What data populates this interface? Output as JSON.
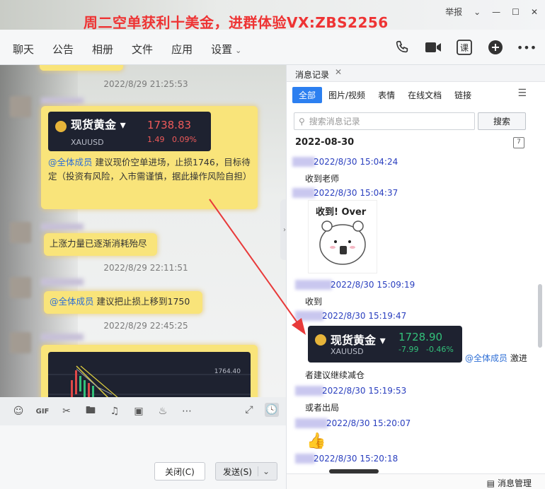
{
  "window": {
    "promo": "周二空单获利十美金，进群体验VX:ZBS2256",
    "report": "举报"
  },
  "tabs": [
    {
      "label": "聊天"
    },
    {
      "label": "公告"
    },
    {
      "label": "相册"
    },
    {
      "label": "文件"
    },
    {
      "label": "应用"
    },
    {
      "label": "设置"
    }
  ],
  "top_icons": [
    "phone-icon",
    "video-icon",
    "class-icon",
    "add-chat-icon",
    "more-icon"
  ],
  "chat": {
    "messages": [
      {
        "time": "2022/8/29 21:25:53"
      },
      {
        "quote": {
          "name": "现货黄金",
          "symbol": "XAUUSD",
          "price": "1738.83",
          "change": "1.49",
          "change_pct": "0.09%"
        },
        "mention": "@全体成员",
        "text": " 建议现价空单进场，止损1746，目标待定（投资有风险，入市需谨慎，据此操作风险自担）"
      },
      {
        "text": "上涨力量已逐渐消耗殆尽"
      },
      {
        "time": "2022/8/29 22:11:51"
      },
      {
        "mention": "@全体成员",
        "text": " 建议把止损上移到1750"
      },
      {
        "time": "2022/8/29 22:45:25"
      },
      {
        "chart_label": "1764.40"
      }
    ],
    "toolbar": [
      "emoji-icon",
      "gif-icon",
      "scissors-icon",
      "folder-icon",
      "music-icon",
      "image-icon",
      "bell-icon",
      "more-icon"
    ],
    "buttons": {
      "close": "关闭(C)",
      "send": "发送(S)"
    }
  },
  "history": {
    "title": "消息记录",
    "filters": [
      "全部",
      "图片/视频",
      "表情",
      "在线文档",
      "链接"
    ],
    "search_placeholder": "搜索消息记录",
    "search_button": "搜索",
    "date": "2022-08-30",
    "calendar_day": "7",
    "entries": [
      {
        "time": "2022/8/30 15:04:24",
        "text": "收到老师"
      },
      {
        "time": "2022/8/30 15:04:37",
        "sticker": "收到! Over"
      },
      {
        "time": "2022/8/30 15:09:19",
        "text": "收到"
      },
      {
        "time": "2022/8/30 15:19:47",
        "quote": {
          "name": "现货黄金",
          "symbol": "XAUUSD",
          "price": "1728.90",
          "change": "-7.99",
          "change_pct": "-0.46%"
        },
        "mention": "@全体成员",
        "tail": "激进"
      },
      {
        "text": "者建议继续减仓"
      },
      {
        "time": "2022/8/30 15:19:53",
        "text": "或者出局"
      },
      {
        "time": "2022/8/30 15:20:07"
      },
      {
        "time": "2022/8/30 15:20:18"
      }
    ],
    "footer": "消息管理"
  }
}
